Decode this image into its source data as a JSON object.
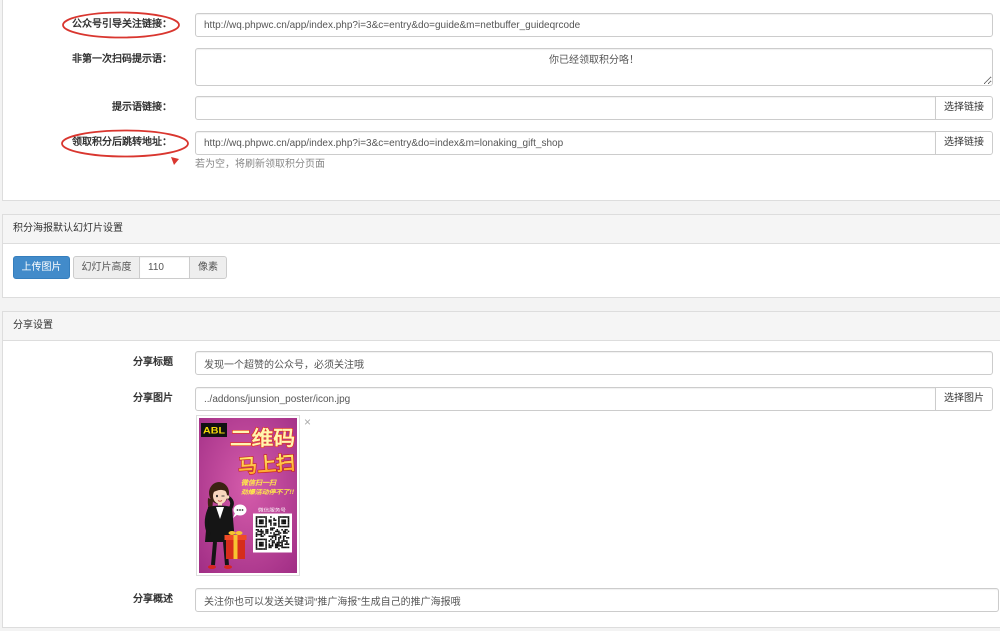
{
  "guide": {
    "follow_link": {
      "label": "公众号引导关注链接：",
      "value": "http://wq.phpwc.cn/app/index.php?i=3&c=entry&do=guide&m=netbuffer_guideqrcode"
    },
    "repeat_scan_tip": {
      "label": "非第一次扫码提示语：",
      "value": "你已经领取积分咯！"
    },
    "tip_link": {
      "label": "提示语链接：",
      "value": "",
      "button": "选择链接"
    },
    "redirect_url": {
      "label": "领取积分后跳转地址：",
      "value": "http://wq.phpwc.cn/app/index.php?i=3&c=entry&do=index&m=lonaking_gift_shop",
      "button": "选择链接",
      "help": "若为空，将刷新领取积分页面"
    }
  },
  "slideshow": {
    "heading": "积分海报默认幻灯片设置",
    "upload_button": "上传图片",
    "height_label": "幻灯片高度",
    "height_value": "110",
    "height_unit": "像素"
  },
  "share": {
    "heading": "分享设置",
    "title": {
      "label": "分享标题",
      "value": "发现一个超赞的公众号，必须关注哦"
    },
    "image": {
      "label": "分享图片",
      "value": "../addons/junsion_poster/icon.jpg",
      "button": "选择图片",
      "remove_icon": "×",
      "remove_icon_name": "close-icon",
      "poster": {
        "logo": "ABL",
        "headline_top": "二维码",
        "headline_bottom": "马上扫",
        "tagline_1": "微信扫一扫",
        "tagline_2": "劲爆活动停不了!!",
        "qr_caption": "微信服务号"
      }
    },
    "description": {
      "label": "分享概述",
      "value": "关注你也可以发送关键词“推广海报”生成自己的推广海报哦"
    }
  },
  "colors": {
    "primary_button": "#428bca",
    "annotation": "#d9362f",
    "poster_background": "#b8409a"
  }
}
